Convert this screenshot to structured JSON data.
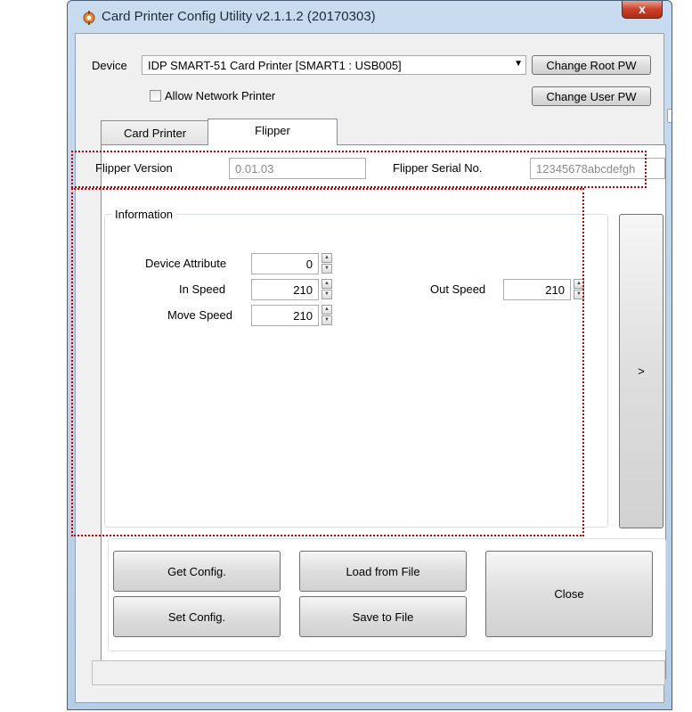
{
  "window": {
    "title": "Card Printer Config Utility v2.1.1.2 (20170303)",
    "close_label": "x"
  },
  "device": {
    "label": "Device",
    "selected": "IDP SMART-51 Card Printer  [SMART1 : USB005]",
    "allow_network_label": "Allow Network Printer",
    "change_root_pw": "Change Root PW",
    "change_user_pw": "Change User PW"
  },
  "tabs": [
    {
      "label": "Card Printer",
      "active": false
    },
    {
      "label": "Flipper",
      "active": true
    }
  ],
  "flipper": {
    "version_label": "Flipper Version",
    "version_value": "0.01.03",
    "serial_label": "Flipper Serial No.",
    "serial_value": "12345678abcdefgh"
  },
  "information": {
    "title": "Information",
    "device_attribute_label": "Device Attribute",
    "device_attribute_value": "0",
    "in_speed_label": "In Speed",
    "in_speed_value": "210",
    "out_speed_label": "Out Speed",
    "out_speed_value": "210",
    "move_speed_label": "Move Speed",
    "move_speed_value": "210",
    "next_label": ">"
  },
  "actions": {
    "get_config": "Get Config.",
    "set_config": "Set Config.",
    "load_from_file": "Load from File",
    "save_to_file": "Save to File",
    "close": "Close"
  },
  "colors": {
    "highlight": "#c00000",
    "title_bar": "#c9dbee",
    "close_button": "#c8412a"
  },
  "icons": {
    "app": "printer-gear-icon",
    "dropdown": "chevron-down-icon",
    "spin": "spin-arrows-icon"
  }
}
